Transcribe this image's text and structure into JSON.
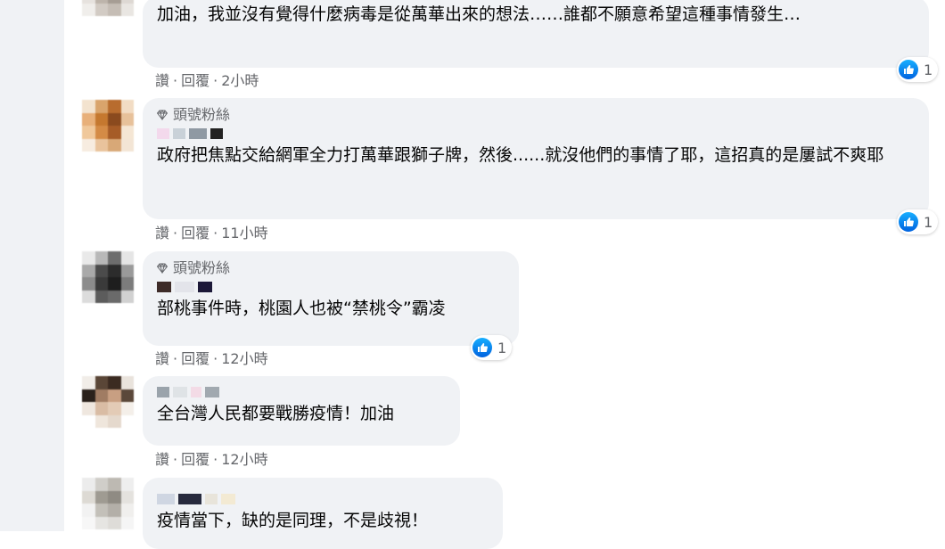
{
  "comments": [
    {
      "text": "加油，我並沒有覺得什麼病毒是從萬華出來的想法……誰都不願意希望這種事情發生…",
      "actions": {
        "like": "讚",
        "reply": "回覆",
        "time": "2小時"
      },
      "reactions": "1",
      "avatar_colors": [
        "#d8d2cc",
        "#c9c0b8",
        "#b7ada3",
        "#e1dcd7",
        "#cfc7bf",
        "#9e948b",
        "#8a8179",
        "#d6d0ca",
        "#e6e2de",
        "#bdb4ab",
        "#a69d94",
        "#ddd8d3",
        "#f0eeeb",
        "#d2cbc4",
        "#c5bdb5",
        "#e9e6e2"
      ]
    },
    {
      "badge": "頭號粉絲",
      "text": "政府把焦點交給網軍全力打萬華跟獅子牌，然後......就沒他們的事情了耶，這招真的是屢試不爽耶",
      "actions": {
        "like": "讚",
        "reply": "回覆",
        "time": "11小時"
      },
      "reactions": "1",
      "avatar_colors": [
        "#f3e3cf",
        "#d9a46c",
        "#b86c2e",
        "#f2dcc4",
        "#e8b07a",
        "#c5782f",
        "#8a4a1e",
        "#e7c19a",
        "#f0c89b",
        "#d48b46",
        "#a65c27",
        "#f5e6d4",
        "#f7ece0",
        "#e9c39c",
        "#d8a877",
        "#f3e5d5"
      ]
    },
    {
      "badge": "頭號粉絲",
      "text": "部桃事件時，桃園人也被“禁桃令”霸凌",
      "actions": {
        "like": "讚",
        "reply": "回覆",
        "time": "12小時"
      },
      "reactions": "1",
      "avatar_colors": [
        "#e9e9e9",
        "#b8b8b8",
        "#6d6d6d",
        "#e5e5e5",
        "#a9a9a9",
        "#4b4b4b",
        "#2c2c2c",
        "#9a9a9a",
        "#8c8c8c",
        "#3a3a3a",
        "#1e1e1e",
        "#7c7c7c",
        "#dcdcdc",
        "#5c5c5c",
        "#6a6a6a",
        "#d1d1d1"
      ]
    },
    {
      "text": "全台灣人民都要戰勝疫情！加油",
      "actions": {
        "like": "讚",
        "reply": "回覆",
        "time": "12小時"
      },
      "avatar_colors": [
        "#f1ede8",
        "#5a4637",
        "#3b2b21",
        "#e9e3dc",
        "#2a211b",
        "#a07c63",
        "#c89f82",
        "#5b483a",
        "#efe7df",
        "#d9bca4",
        "#e3cbb6",
        "#f4efe9",
        "#ffffff",
        "#efe6dc",
        "#e5d9cd",
        "#ffffff"
      ]
    },
    {
      "text": "疫情當下，缺的是同理，不是歧視！",
      "avatar_colors": [
        "#ececec",
        "#d0cec9",
        "#bdb9b2",
        "#eeeeee",
        "#dddad4",
        "#9f9b92",
        "#8f8b83",
        "#e4e2de",
        "#f2f2f2",
        "#c3c0b9",
        "#b3afa8",
        "#f0efed",
        "#f7f7f7",
        "#e6e5e2",
        "#dedcd8",
        "#f5f5f5"
      ]
    }
  ],
  "colors": {
    "like_blue": "#1877f2",
    "bubble_bg": "#f0f2f5",
    "meta_text": "#65676b"
  }
}
